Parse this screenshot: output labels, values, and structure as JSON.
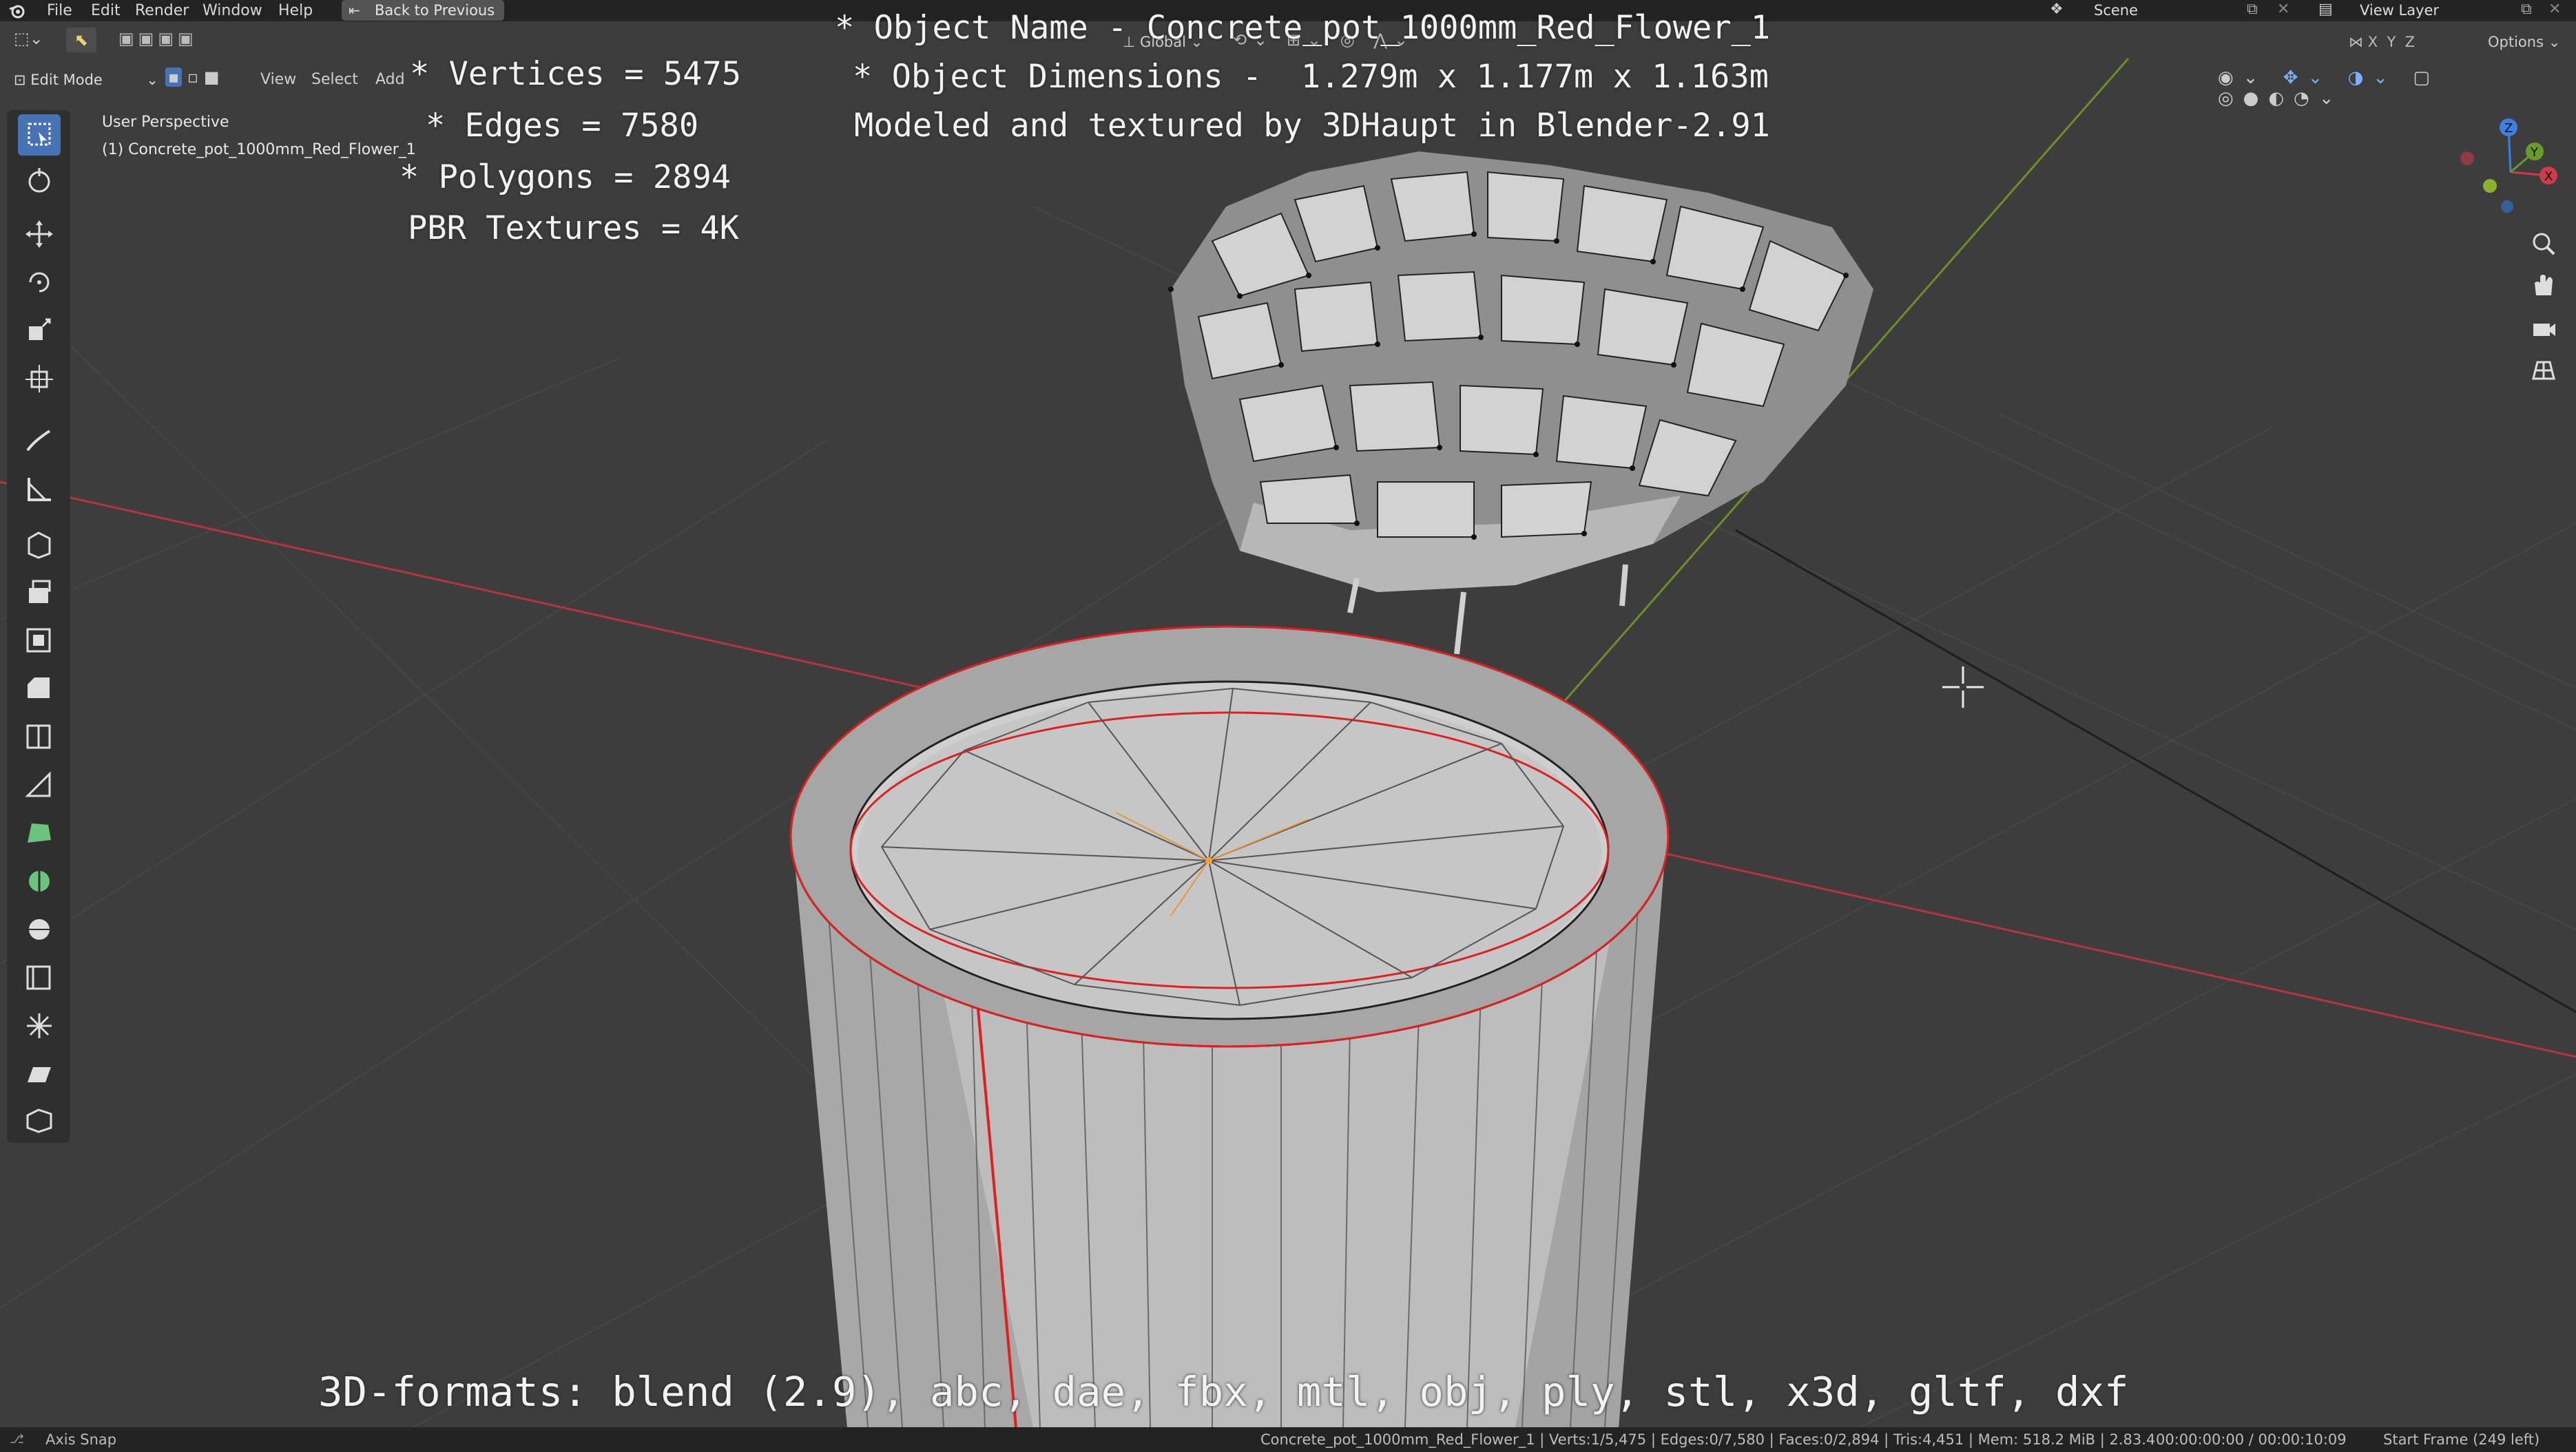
{
  "menu": {
    "items": [
      "File",
      "Edit",
      "Render",
      "Window",
      "Help"
    ],
    "back_button": "Back to Previous"
  },
  "top_right": {
    "scene": "Scene",
    "view_layer": "View Layer",
    "options": "Options"
  },
  "header": {
    "mode": "Edit Mode",
    "view": "View",
    "select": "Select",
    "add": "Add",
    "transform": "Global",
    "axes": [
      "X",
      "Y",
      "Z"
    ]
  },
  "viewport": {
    "view_name": "User Perspective",
    "object_label": "(1) Concrete_pot_1000mm_Red_Flower_1"
  },
  "overlay": {
    "vertices": "* Vertices = 5475",
    "edges": "* Edges = 7580",
    "polygons": "* Polygons = 2894",
    "textures": "PBR Textures = 4K",
    "object_name": "* Object Name - Concrete_pot_1000mm_Red_Flower_1",
    "dimensions": "* Object Dimensions -  1.279m x 1.177m x 1.163m",
    "credit": "Modeled and textured by 3DHaupt in Blender-2.91",
    "formats": "3D-formats: blend (2.9), abc, dae, fbx, mtl, obj, ply, stl, x3d, gltf, dxf"
  },
  "status": {
    "left": "Axis Snap",
    "stats": "Concrete_pot_1000mm_Red_Flower_1 | Verts:1/5,475 | Edges:0/7,580 | Faces:0/2,894 | Tris:4,451 | Mem: 518.2 MiB | 2.83.4",
    "time": "00:00:00:00 / 00:00:10:09",
    "frame": "Start Frame (249 left)"
  },
  "colors": {
    "accent": "#4772b3",
    "x_axis": "#c9364b",
    "y_axis": "#7d9b2e",
    "seam": "#e02020"
  }
}
